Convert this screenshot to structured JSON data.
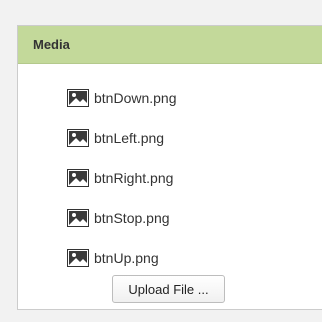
{
  "panel": {
    "title": "Media"
  },
  "files": [
    {
      "name": "btnDown.png",
      "icon": "image-file-icon"
    },
    {
      "name": "btnLeft.png",
      "icon": "image-file-icon"
    },
    {
      "name": "btnRight.png",
      "icon": "image-file-icon"
    },
    {
      "name": "btnStop.png",
      "icon": "image-file-icon"
    },
    {
      "name": "btnUp.png",
      "icon": "image-file-icon"
    }
  ],
  "upload": {
    "label": "Upload File ..."
  },
  "colors": {
    "header_bg": "#c3d99a",
    "panel_border": "#cccccc",
    "text": "#333333"
  }
}
